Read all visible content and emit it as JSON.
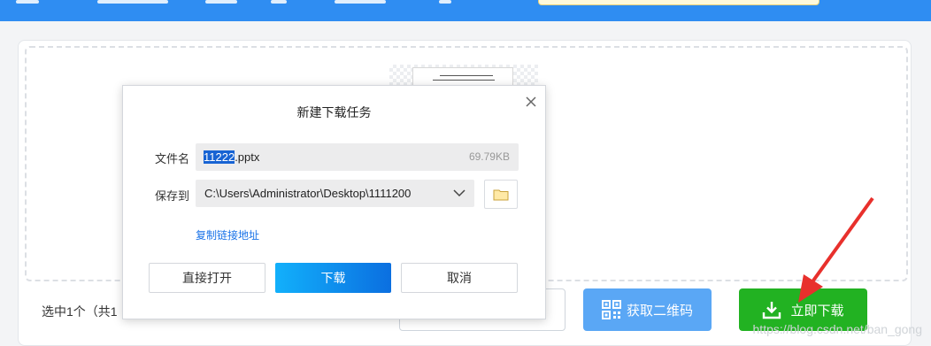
{
  "dialog": {
    "title": "新建下载任务",
    "filename_label": "文件名",
    "filename_selected": "11222",
    "filename_ext": ".pptx",
    "filesize": "69.79KB",
    "saveto_label": "保存到",
    "save_path": "C:\\Users\\Administrator\\Desktop\\1111200",
    "copy_link": "复制链接地址",
    "btn_open": "直接打开",
    "btn_download": "下载",
    "btn_cancel": "取消"
  },
  "background": {
    "selected_info": "选中1个（共1",
    "qr_button": "获取二维码",
    "download_now_button": "立即下载"
  },
  "watermark": "https://blog.csdn.net/ban_gong",
  "colors": {
    "topbar": "#2f8df2",
    "primary_blue": "#0b6fe0",
    "qr_blue": "#5aa7f5",
    "download_green": "#22b222",
    "annotation_red": "#e8302c"
  }
}
